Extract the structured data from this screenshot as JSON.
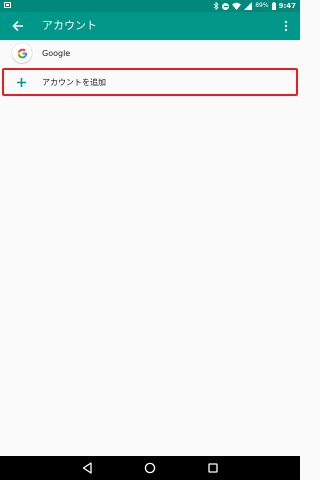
{
  "status_bar": {
    "battery_percent": "89%",
    "time": "9:47",
    "icons": [
      "screenshot-icon",
      "bluetooth-icon",
      "do-not-disturb-icon",
      "wifi-icon",
      "signal-icon",
      "battery-icon"
    ]
  },
  "app_bar": {
    "title": "アカウント",
    "back_icon": "back-arrow-icon",
    "menu_icon": "more-vert-icon"
  },
  "accounts": {
    "items": [
      {
        "label": "Google",
        "icon": "google-icon"
      }
    ],
    "add_account": {
      "label": "アカウントを追加",
      "icon": "plus-icon"
    }
  },
  "colors": {
    "status_bar": "#00897b",
    "app_bar": "#009688",
    "accent": "#009688",
    "highlight": "#ea1d23",
    "background": "#fafafa",
    "nav_bar": "#000000"
  },
  "nav_bar": {
    "icons": [
      "back-icon",
      "home-icon",
      "recents-icon"
    ]
  }
}
